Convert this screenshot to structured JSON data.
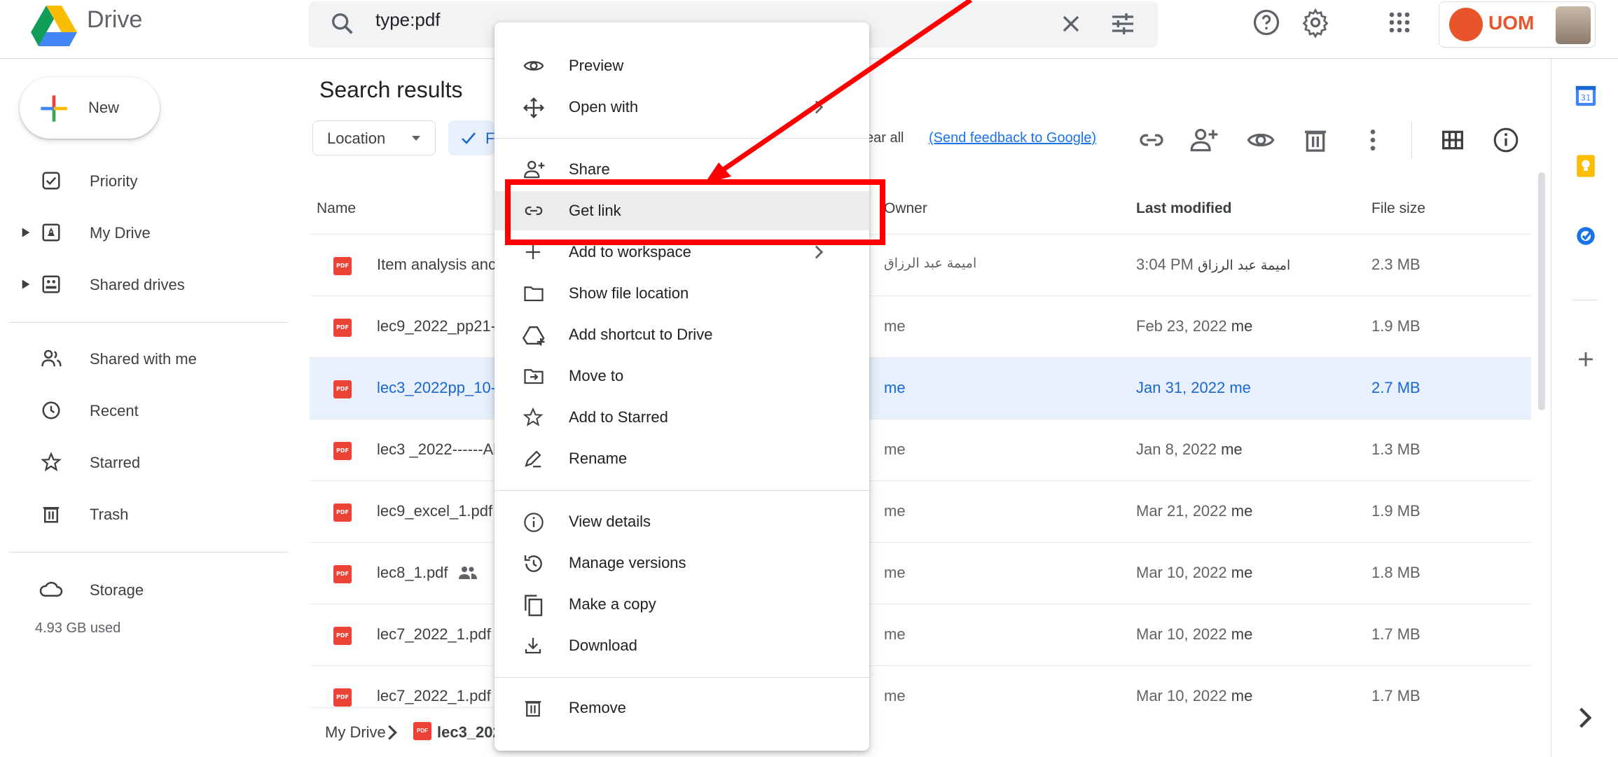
{
  "header": {
    "brand": "Drive",
    "search_value": "type:pdf",
    "account_label": "UOM"
  },
  "sidebar": {
    "new_label": "New",
    "items": [
      {
        "label": "Priority"
      },
      {
        "label": "My Drive"
      },
      {
        "label": "Shared drives"
      },
      {
        "label": "Shared with me"
      },
      {
        "label": "Recent"
      },
      {
        "label": "Starred"
      },
      {
        "label": "Trash"
      },
      {
        "label": "Storage"
      }
    ],
    "storage_used": "4.93 GB used"
  },
  "main": {
    "title": "Search results",
    "filter_location": "Location",
    "filter_active_partial": "F",
    "clear_all_partial": "ear all",
    "feedback": "(Send feedback to Google)",
    "columns": {
      "name": "Name",
      "owner": "Owner",
      "modified": "Last modified",
      "size": "File size"
    },
    "rows": [
      {
        "name": "Item analysis anc",
        "owner": "اميمة عبد الرزاق",
        "modified_date": "3:04 PM",
        "modified_by": "اميمة عبد الرزاق",
        "size": "2.3 MB"
      },
      {
        "name": "lec9_2022_pp21-",
        "owner": "me",
        "modified_date": "Feb 23, 2022",
        "modified_by": "me",
        "size": "1.9 MB"
      },
      {
        "name": "lec3_2022pp_10-",
        "owner": "me",
        "modified_date": "Jan 31, 2022",
        "modified_by": "me",
        "size": "2.7 MB"
      },
      {
        "name": "lec3 _2022------Al",
        "owner": "me",
        "modified_date": "Jan 8, 2022",
        "modified_by": "me",
        "size": "1.3 MB"
      },
      {
        "name": "lec9_excel_1.pdf",
        "owner": "me",
        "modified_date": "Mar 21, 2022",
        "modified_by": "me",
        "size": "1.9 MB"
      },
      {
        "name": "lec8_1.pdf",
        "owner": "me",
        "modified_date": "Mar 10, 2022",
        "modified_by": "me",
        "size": "1.8 MB"
      },
      {
        "name": "lec7_2022_1.pdf",
        "owner": "me",
        "modified_date": "Mar 10, 2022",
        "modified_by": "me",
        "size": "1.7 MB"
      },
      {
        "name": "lec7_2022_1.pdf",
        "owner": "me",
        "modified_date": "Mar 10, 2022",
        "modified_by": "me",
        "size": "1.7 MB"
      }
    ],
    "pdf_badge": "PDF",
    "breadcrumb_root": "My Drive",
    "breadcrumb_file": "lec3_202"
  },
  "context_menu": {
    "items": [
      {
        "label": "Preview"
      },
      {
        "label": "Open with"
      },
      {
        "label": "Share"
      },
      {
        "label": "Get link"
      },
      {
        "label": "Add to workspace"
      },
      {
        "label": "Show file location"
      },
      {
        "label": "Add shortcut to Drive"
      },
      {
        "label": "Move to"
      },
      {
        "label": "Add to Starred"
      },
      {
        "label": "Rename"
      },
      {
        "label": "View details"
      },
      {
        "label": "Manage versions"
      },
      {
        "label": "Make a copy"
      },
      {
        "label": "Download"
      },
      {
        "label": "Remove"
      }
    ]
  },
  "colors": {
    "accent": "#1a73e8",
    "selected_row": "#e8f0fe",
    "annotation": "#ff0000",
    "pdf": "#ea4335"
  }
}
